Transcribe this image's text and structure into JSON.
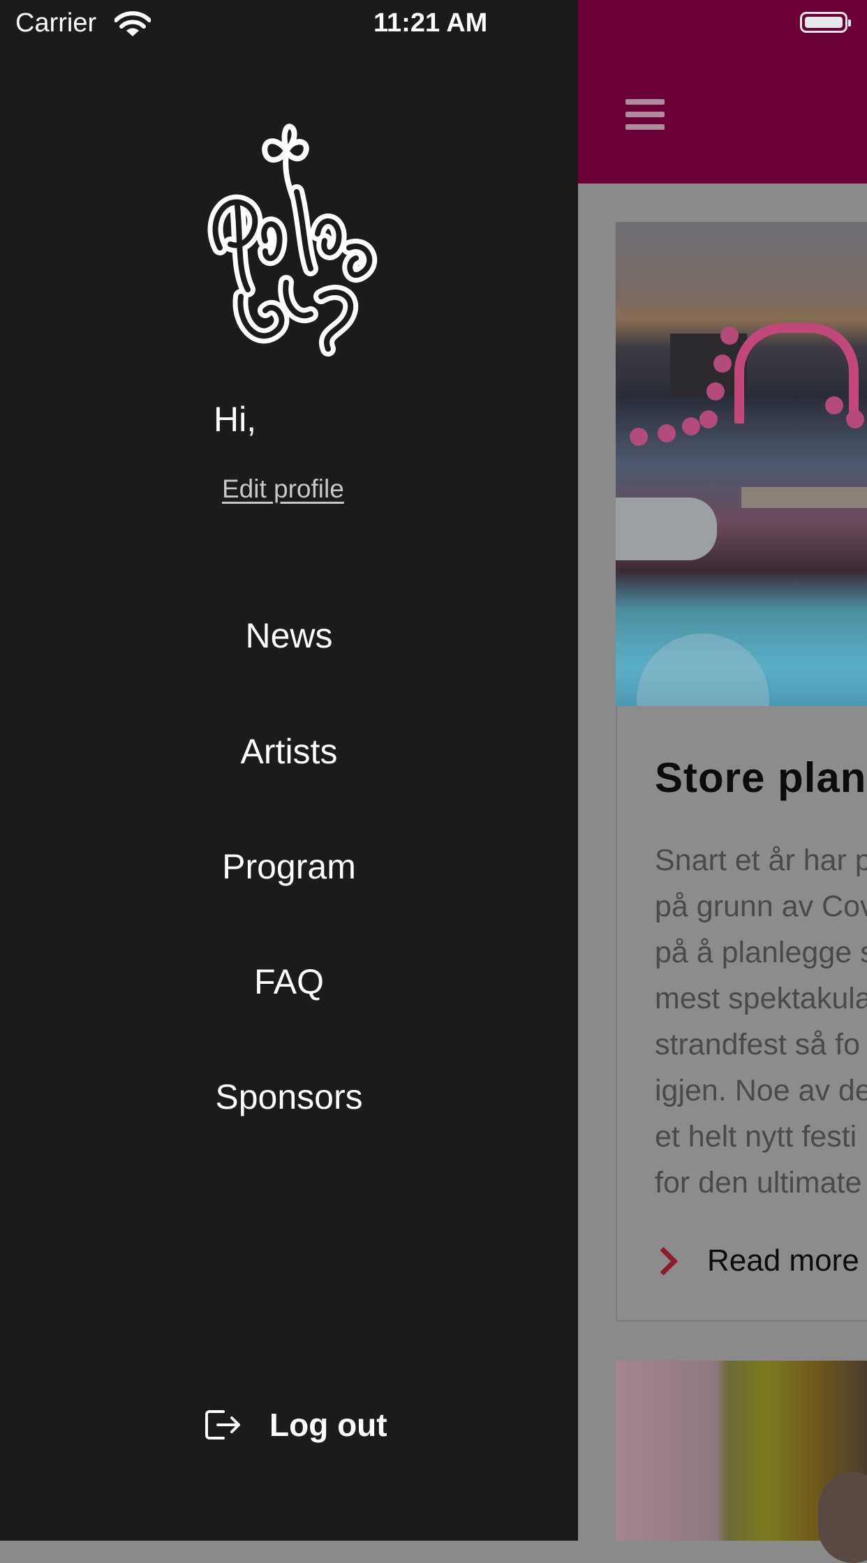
{
  "status_bar": {
    "carrier": "Carrier",
    "time": "11:21 AM"
  },
  "drawer": {
    "greeting": "Hi,",
    "edit_profile": "Edit profile",
    "menu": [
      {
        "label": "News"
      },
      {
        "label": "Artists"
      },
      {
        "label": "Program"
      },
      {
        "label": "FAQ"
      },
      {
        "label": "Sponsors"
      }
    ],
    "logout_label": "Log out"
  },
  "news_card": {
    "title": "Store plan",
    "body_lines": [
      "Snart et år har p",
      "på grunn av Cov",
      "på å planlegge s",
      "mest spektakula",
      "strandfest så fo",
      "igjen. Noe av de",
      "et helt nytt festi",
      "for den ultimate"
    ],
    "read_more": "Read more"
  },
  "colors": {
    "header": "#6a0036",
    "drawer_bg": "#1b1b1b",
    "chevron": "#8a1c2c"
  }
}
